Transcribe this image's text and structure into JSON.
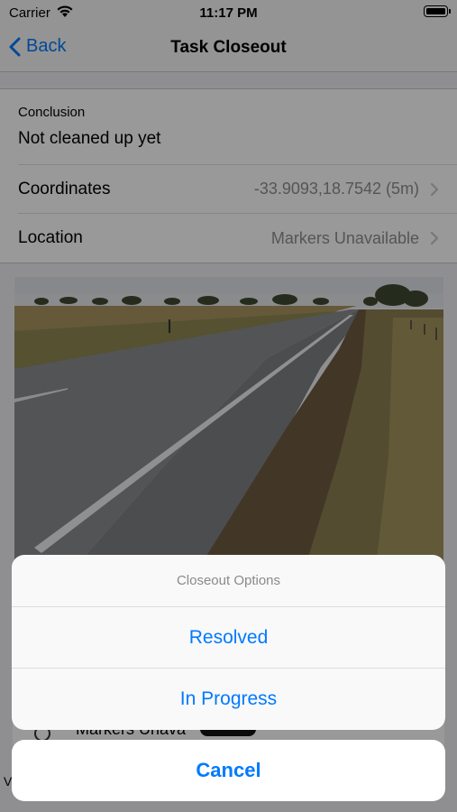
{
  "status_bar": {
    "carrier": "Carrier",
    "time": "11:17 PM"
  },
  "nav": {
    "back_label": "Back",
    "title": "Task Closeout"
  },
  "form": {
    "conclusion_label": "Conclusion",
    "conclusion_value": "Not cleaned up yet",
    "coordinates_label": "Coordinates",
    "coordinates_value": "-33.9093,18.7542 (5m)",
    "location_label": "Location",
    "location_value": "Markers Unavailable"
  },
  "background": {
    "partial_row_text": "Markers Unava",
    "partial_left_text": "V"
  },
  "action_sheet": {
    "title": "Closeout Options",
    "options": [
      "Resolved",
      "In Progress"
    ],
    "cancel_label": "Cancel"
  },
  "colors": {
    "accent": "#007aff",
    "secondary_text": "#8e8e93"
  },
  "icons": [
    "wifi-icon",
    "battery-icon",
    "back-chevron-icon",
    "chevron-right-icon"
  ]
}
